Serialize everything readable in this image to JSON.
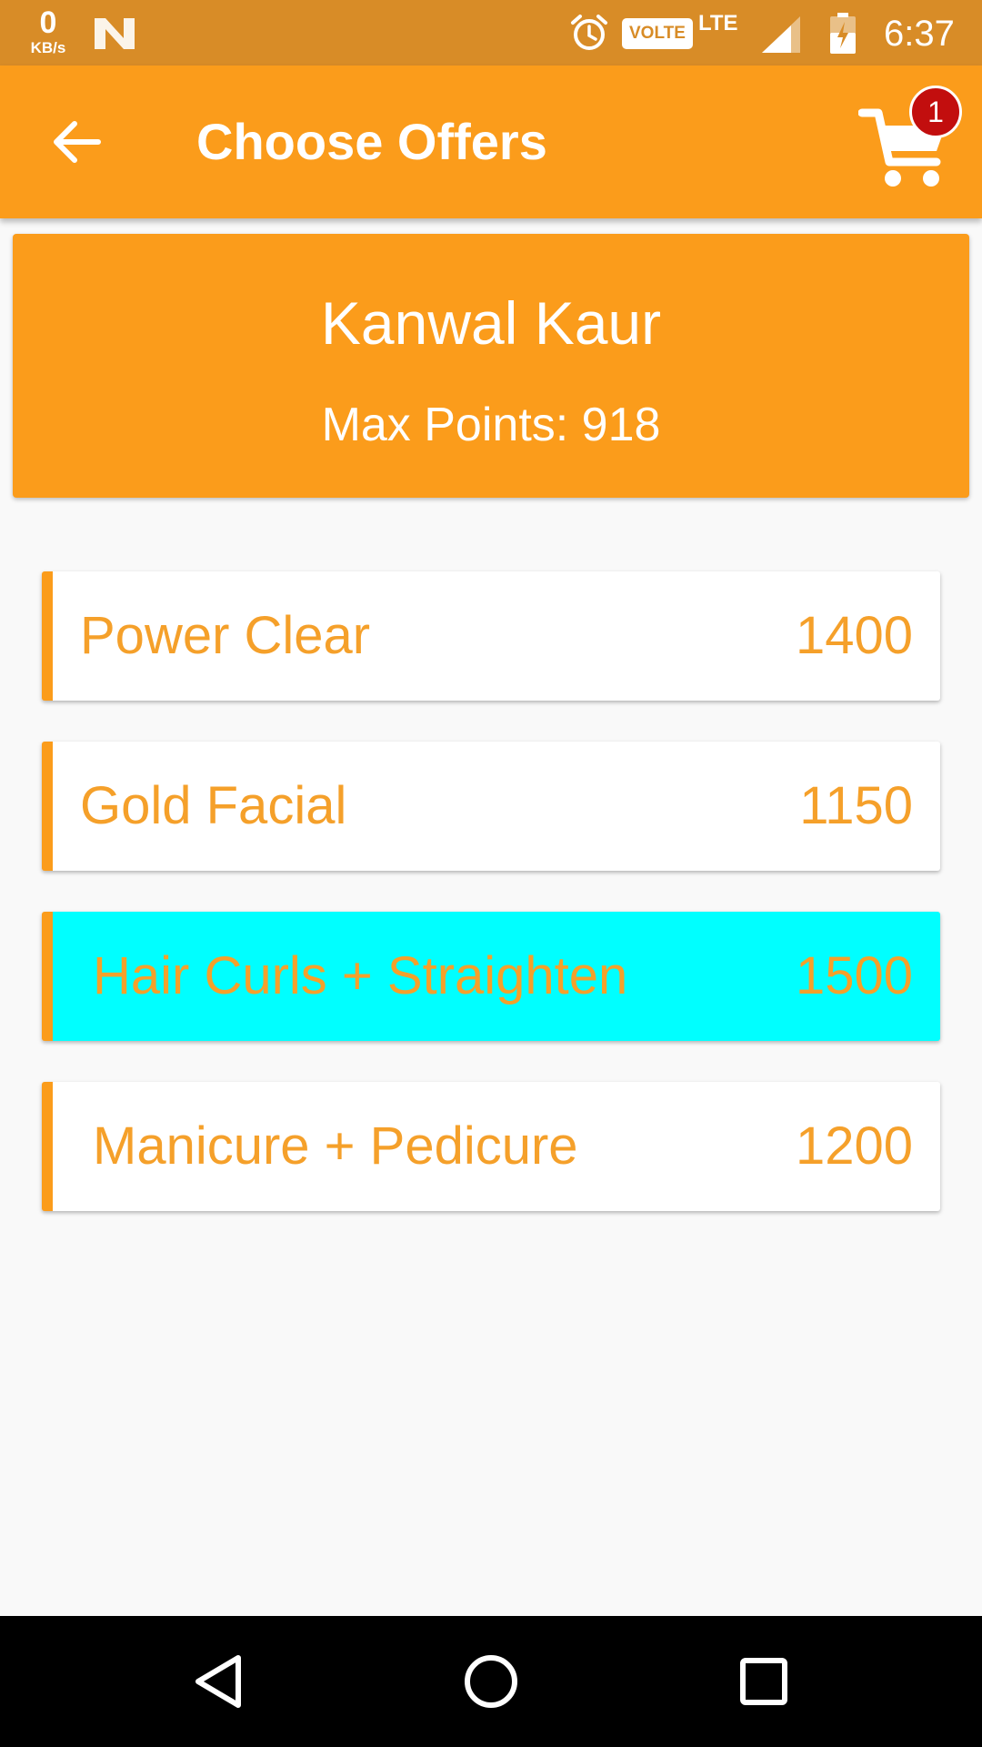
{
  "status_bar": {
    "net_speed_value": "0",
    "net_speed_unit": "KB/s",
    "volte": "VOLTE",
    "network": "LTE",
    "time": "6:37"
  },
  "app_bar": {
    "title": "Choose Offers",
    "cart_count": "1"
  },
  "profile": {
    "name": "Kanwal Kaur",
    "max_points": "Max Points: 918"
  },
  "offers": [
    {
      "name": "Power Clear",
      "points": "1400",
      "selected": false
    },
    {
      "name": "Gold Facial",
      "points": "1150",
      "selected": false
    },
    {
      "name": "Hair Curls + Straighten",
      "points": "1500",
      "selected": true
    },
    {
      "name": "Manicure + Pedicure",
      "points": "1200",
      "selected": false
    }
  ],
  "icons": {
    "back": "arrow-left-icon",
    "cart": "shopping-cart-icon",
    "alarm": "alarm-clock-icon",
    "signal": "cell-signal-icon",
    "battery": "battery-charging-icon",
    "nav_back": "triangle-back-icon",
    "nav_home": "circle-home-icon",
    "nav_recents": "square-recents-icon"
  },
  "colors": {
    "status_bar": "#d88c27",
    "primary": "#fb9c1b",
    "offer_text": "#f5a02a",
    "selected_item": "#00ffff",
    "badge": "#c20e0e"
  }
}
